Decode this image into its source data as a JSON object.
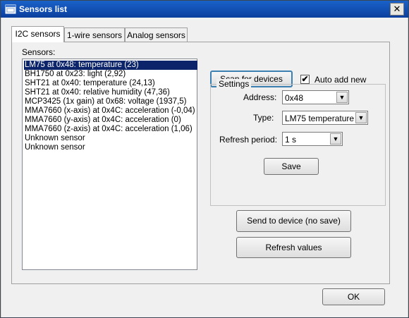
{
  "window": {
    "title": "Sensors list",
    "close_glyph": "✕"
  },
  "tabs": [
    {
      "label": "I2C sensors",
      "active": true
    },
    {
      "label": "1-wire sensors",
      "active": false
    },
    {
      "label": "Analog sensors",
      "active": false
    }
  ],
  "sensors": {
    "label": "Sensors:",
    "items": [
      "LM75 at 0x48: temperature (23)",
      "BH1750 at 0x23: light (2,92)",
      "SHT21 at 0x40: temperature (24,13)",
      "SHT21 at 0x40: relative humidity (47,36)",
      "MCP3425 (1x gain) at 0x68: voltage (1937,5)",
      "MMA7660 (x-axis) at 0x4C: acceleration (-0,04)",
      "MMA7660 (y-axis) at 0x4C: acceleration (0)",
      "MMA7660 (z-axis) at 0x4C: acceleration (1,06)",
      "Unknown sensor",
      "Unknown sensor"
    ],
    "selected_index": 0
  },
  "scan": {
    "button_label": "Scan for devices",
    "auto_add_label": "Auto add new",
    "auto_add_checked": true,
    "check_glyph": "✔"
  },
  "settings": {
    "legend": "Settings",
    "address_label": "Address:",
    "address_value": "0x48",
    "type_label": "Type:",
    "type_value": "LM75 temperature",
    "refresh_label": "Refresh period:",
    "refresh_value": "1 s",
    "save_label": "Save",
    "dropdown_glyph": "▼"
  },
  "actions": {
    "send_label": "Send to device (no save)",
    "refresh_label": "Refresh values"
  },
  "footer": {
    "ok_label": "OK"
  }
}
